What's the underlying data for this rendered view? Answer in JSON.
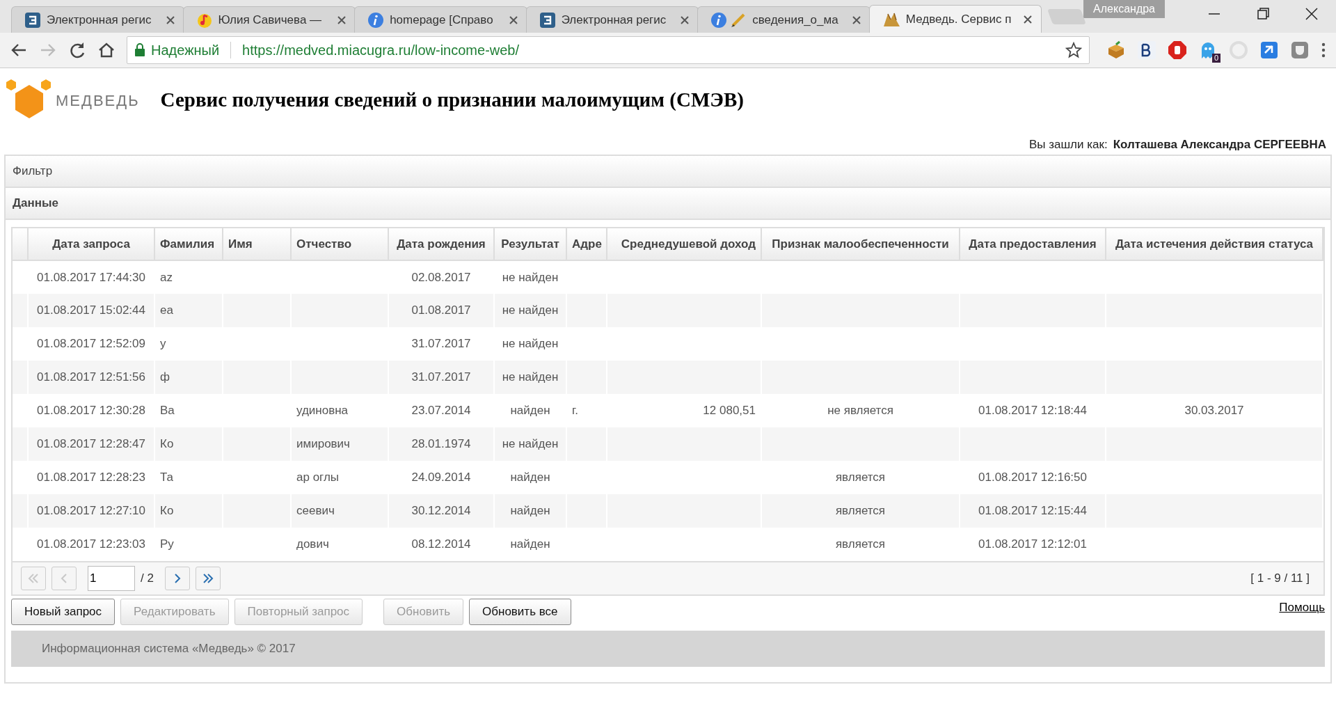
{
  "browser": {
    "tabs": [
      {
        "title": "Электронная регис",
        "kind": "e-logo",
        "selected": false
      },
      {
        "title": "Юлия Савичева —",
        "kind": "music",
        "selected": false
      },
      {
        "title": "homepage [Справо",
        "kind": "info",
        "selected": false
      },
      {
        "title": "Электронная регис",
        "kind": "e-logo",
        "selected": false
      },
      {
        "title": "сведения_о_ма",
        "kind": "info-pencil",
        "selected": false
      },
      {
        "title": "Медведь. Сервис п",
        "kind": "medved",
        "selected": true
      }
    ],
    "profile": "Александра",
    "address": {
      "security": "Надежный",
      "url": "https://medved.miacugra.ru/low-income-web/"
    },
    "extension_badge": "0"
  },
  "page": {
    "logo_text": "МЕДВЕДЬ",
    "title": "Сервис получения сведений о признании малоимущим (СМЭВ)",
    "login_label": "Вы зашли как:",
    "user_name": "Колташева Александра СЕРГЕЕВНА",
    "filter_panel": "Фильтр",
    "data_panel": "Данные",
    "table": {
      "columns": [
        "Дата запроса",
        "Фамилия",
        "Имя",
        "Отчество",
        "Дата рождения",
        "Результат",
        "Адре",
        "Среднедушевой доход",
        "Признак малообеспеченности",
        "Дата предоставления",
        "Дата истечения действия статуса"
      ],
      "rows": [
        [
          "01.08.2017 17:44:30",
          "az",
          null,
          null,
          "02.08.2017",
          "не найден",
          null,
          null,
          null,
          null,
          null
        ],
        [
          "01.08.2017 15:02:44",
          "ea",
          null,
          null,
          "01.08.2017",
          "не найден",
          null,
          null,
          null,
          null,
          null
        ],
        [
          "01.08.2017 12:52:09",
          "у",
          null,
          null,
          "31.07.2017",
          "не найден",
          null,
          null,
          null,
          null,
          null
        ],
        [
          "01.08.2017 12:51:56",
          "ф",
          null,
          null,
          "31.07.2017",
          "не найден",
          null,
          null,
          null,
          null,
          null
        ],
        [
          "01.08.2017 12:30:28",
          "Ва",
          null,
          "удиновна",
          "23.07.2014",
          "найден",
          "г.",
          "12 080,51",
          "не является",
          "01.08.2017 12:18:44",
          "30.03.2017"
        ],
        [
          "01.08.2017 12:28:47",
          "Ко",
          null,
          "имирович",
          "28.01.1974",
          "не найден",
          null,
          null,
          null,
          null,
          null
        ],
        [
          "01.08.2017 12:28:23",
          "Та",
          null,
          "ар оглы",
          "24.09.2014",
          "найден",
          null,
          null,
          "является",
          "01.08.2017 12:16:50",
          null
        ],
        [
          "01.08.2017 12:27:10",
          "Ко",
          null,
          "сеевич",
          "30.12.2014",
          "найден",
          null,
          null,
          "является",
          "01.08.2017 12:15:44",
          null
        ],
        [
          "01.08.2017 12:23:03",
          "Ру",
          null,
          "дович",
          "08.12.2014",
          "найден",
          null,
          null,
          "является",
          "01.08.2017 12:12:01",
          null
        ]
      ]
    },
    "pager": {
      "first_disabled": true,
      "prev_disabled": true,
      "next_disabled": false,
      "last_disabled": false,
      "page": "1",
      "total_pages": "/ 2",
      "range": "[ 1 - 9 / 11 ]"
    },
    "buttons": [
      {
        "label": "Новый запрос",
        "disabled": false
      },
      {
        "label": "Редактировать",
        "disabled": true
      },
      {
        "label": "Повторный запрос",
        "disabled": true
      },
      {
        "label": "Обновить",
        "disabled": true
      },
      {
        "label": "Обновить все",
        "disabled": false
      }
    ],
    "help_link": "Помощь",
    "footer": "Информационная система «Медведь» © 2017"
  }
}
